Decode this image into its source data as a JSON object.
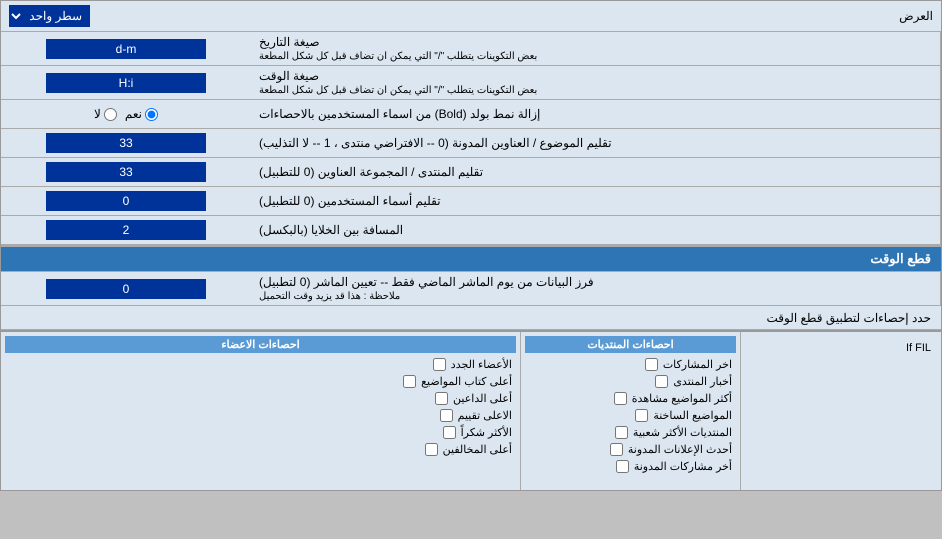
{
  "page": {
    "title": "العرض",
    "top_row_label": "سطر واحد",
    "sections": [
      {
        "id": "date_format",
        "label": "صيغة التاريخ",
        "sublabel": "بعض التكوينات يتطلب \"/\" التي يمكن ان تضاف قبل كل شكل المطعة",
        "input_value": "d-m",
        "input_type": "text"
      },
      {
        "id": "time_format",
        "label": "صيغة الوقت",
        "sublabel": "بعض التكوينات يتطلب \"/\" التي يمكن ان تضاف قبل كل شكل المطعة",
        "input_value": "H:i",
        "input_type": "text"
      },
      {
        "id": "bold_remove",
        "label": "إزالة نمط بولد (Bold) من اسماء المستخدمين بالاحصاءات",
        "input_type": "radio",
        "radio_options": [
          "نعم",
          "لا"
        ],
        "radio_selected": "نعم"
      },
      {
        "id": "topic_sort",
        "label": "تقليم الموضوع / العناوين المدونة (0 -- الافتراضي منتدى ، 1 -- لا التذليب)",
        "input_value": "33",
        "input_type": "text"
      },
      {
        "id": "forum_sort",
        "label": "تقليم المنتدى / المجموعة العناوين (0 للتطبيل)",
        "input_value": "33",
        "input_type": "text"
      },
      {
        "id": "user_sort",
        "label": "تقليم أسماء المستخدمين (0 للتطبيل)",
        "input_value": "0",
        "input_type": "text"
      },
      {
        "id": "cell_spacing",
        "label": "المسافة بين الخلايا (بالبكسل)",
        "input_value": "2",
        "input_type": "text"
      }
    ],
    "time_cut_section": {
      "title": "قطع الوقت",
      "row": {
        "label": "فرز البيانات من يوم الماشر الماضي فقط -- تعيين الماشر (0 لتطبيل)",
        "note": "ملاحظة : هذا قد يزيد وقت التحميل",
        "input_value": "0"
      },
      "apply_label": "حدد إحصاءات لتطبيق قطع الوقت"
    },
    "stats_section": {
      "posts_title": "احصاءات المنتديات",
      "members_title": "احصاءات الاعضاء",
      "posts_items": [
        "اخر المشاركات",
        "أخبار المنتدى",
        "أكثر المواضيع مشاهدة",
        "المواضيع الساخنة",
        "المنتديات الأكثر شعبية",
        "أحدث الإعلانات المدونة",
        "أخر مشاركات المدونة"
      ],
      "members_items": [
        "الأعضاء الجدد",
        "أعلى كتاب المواضيع",
        "أعلى الداعين",
        "الاعلى تقييم",
        "الأكثر شكراً",
        "أعلى المخالفين"
      ],
      "members_title2": "احصاءات الاعضاء",
      "if_fil_text": "If FIL"
    }
  }
}
